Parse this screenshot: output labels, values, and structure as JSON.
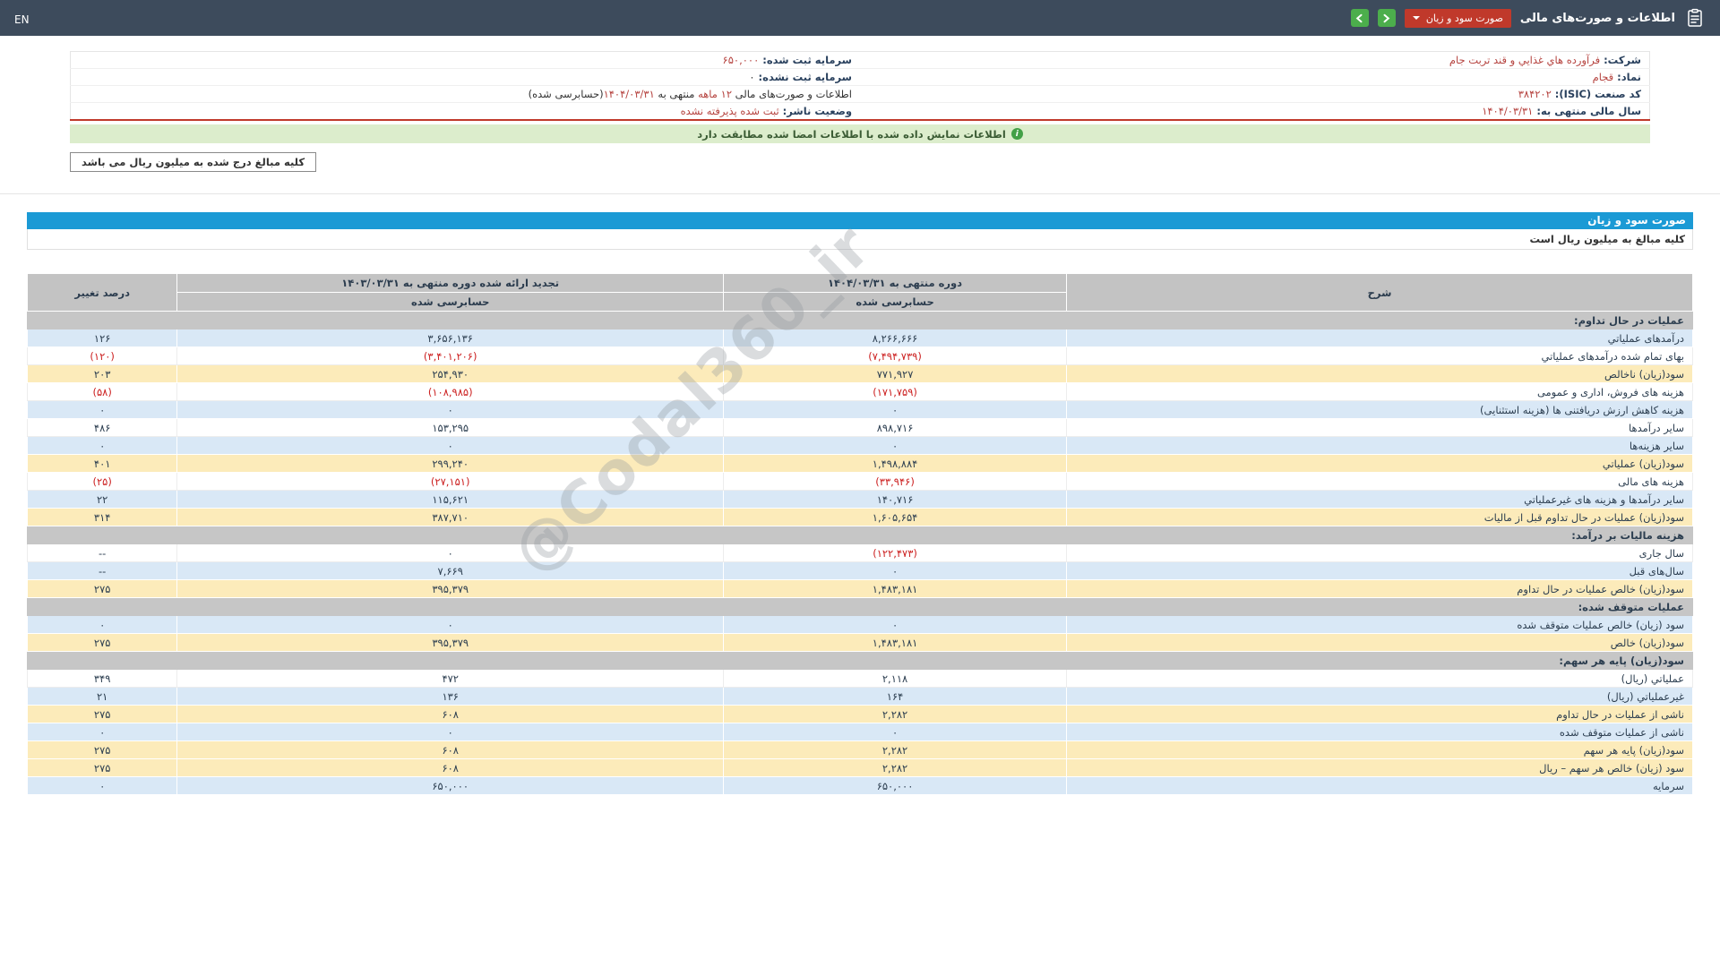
{
  "navbar": {
    "en_label": "EN",
    "title": "اطلاعات و صورت‌های مالی",
    "statement_select_label": "صورت سود و زیان",
    "icons": {
      "report_icon": "clipboard",
      "select_caret": "chevron-down",
      "next_button": "chevron-right",
      "prev_button": "chevron-left"
    }
  },
  "info_panel": {
    "rows": [
      {
        "right": [
          {
            "t": "شرکت: ",
            "c": "lbl"
          },
          {
            "t": "فرآورده هاي غذايي و قند تربت جام",
            "c": "red"
          }
        ],
        "left": [
          {
            "t": "سرمایه ثبت شده: ",
            "c": "lbl"
          },
          {
            "t": "۶۵۰,۰۰۰",
            "c": "red"
          }
        ]
      },
      {
        "right": [
          {
            "t": "نماد: ",
            "c": "lbl"
          },
          {
            "t": "قجام",
            "c": "red"
          }
        ],
        "left": [
          {
            "t": "سرمایه ثبت نشده: ",
            "c": "lbl"
          },
          {
            "t": "۰",
            "c": "plain"
          }
        ]
      },
      {
        "right": [
          {
            "t": "کد صنعت (ISIC): ",
            "c": "lbl"
          },
          {
            "t": "۳۸۴۲۰۲",
            "c": "red"
          }
        ],
        "left": [
          {
            "t": "اطلاعات و صورت‌های مالی ",
            "c": "plain"
          },
          {
            "t": "۱۲ ماهه",
            "c": "red"
          },
          {
            "t": " منتهی به ",
            "c": "plain"
          },
          {
            "t": "۱۴۰۴/۰۳/۳۱",
            "c": "red"
          },
          {
            "t": "(حسابرسی شده)",
            "c": "plain"
          }
        ]
      },
      {
        "right": [
          {
            "t": "سال مالی منتهی به: ",
            "c": "lbl"
          },
          {
            "t": "۱۴۰۴/۰۳/۳۱",
            "c": "red"
          }
        ],
        "left": [
          {
            "t": "وضعیت ناشر: ",
            "c": "lbl"
          },
          {
            "t": "ثبت شده پذیرفته نشده",
            "c": "red"
          }
        ]
      }
    ],
    "signature_note": "اطلاعات نمایش داده شده با اطلاعات امضا شده مطابقت دارد",
    "info_icon_glyph": "i",
    "currency_note": "کلیه مبالغ درج شده به میلیون ریال می باشد"
  },
  "statement": {
    "title": "صورت سود و زیان",
    "unit_note": "کلیه مبالغ به میلیون ریال است",
    "watermark": "@Codal360_ir",
    "header": {
      "desc": "شرح",
      "current_period": "دوره منتهی به ۱۴۰۴/۰۳/۳۱",
      "prior_period": "تجدید ارائه شده دوره منتهی به ۱۴۰۳/۰۳/۳۱",
      "audited": "حسابرسی شده",
      "change": "درصد تغییر"
    },
    "rows": [
      {
        "type": "section",
        "desc": "عملیات در حال تداوم:"
      },
      {
        "type": "data",
        "style": "blue",
        "desc": "درآمدهای عملیاتي",
        "current": "۸,۲۶۶,۶۶۶",
        "prior": "۳,۶۵۶,۱۳۶",
        "change": "۱۲۶"
      },
      {
        "type": "data",
        "style": "white",
        "desc": "بهای تمام شده درآمدهای عملیاتي",
        "current": "(۷,۴۹۴,۷۳۹)",
        "prior": "(۳,۴۰۱,۲۰۶)",
        "change": "(۱۲۰)"
      },
      {
        "type": "data",
        "style": "yellow",
        "desc": "سود(زیان) ناخالص",
        "current": "۷۷۱,۹۲۷",
        "prior": "۲۵۴,۹۳۰",
        "change": "۲۰۳"
      },
      {
        "type": "data",
        "style": "white",
        "desc": "هزینه های فروش، اداری و عمومی",
        "current": "(۱۷۱,۷۵۹)",
        "prior": "(۱۰۸,۹۸۵)",
        "change": "(۵۸)"
      },
      {
        "type": "data",
        "style": "blue",
        "desc": "هزینه کاهش ارزش دریافتنی ها (هزینه استثنایی)",
        "current": "۰",
        "prior": "۰",
        "change": "۰"
      },
      {
        "type": "data",
        "style": "white",
        "desc": "سایر درآمدها",
        "current": "۸۹۸,۷۱۶",
        "prior": "۱۵۳,۲۹۵",
        "change": "۴۸۶"
      },
      {
        "type": "data",
        "style": "blue",
        "desc": "سایر هزینه‌ها",
        "current": "۰",
        "prior": "۰",
        "change": "۰"
      },
      {
        "type": "data",
        "style": "yellow",
        "desc": "سود(زیان) عملیاتي",
        "current": "۱,۴۹۸,۸۸۴",
        "prior": "۲۹۹,۲۴۰",
        "change": "۴۰۱"
      },
      {
        "type": "data",
        "style": "white",
        "desc": "هزینه های مالی",
        "current": "(۳۳,۹۴۶)",
        "prior": "(۲۷,۱۵۱)",
        "change": "(۲۵)"
      },
      {
        "type": "data",
        "style": "blue",
        "desc": "سایر درآمدها و هزینه های غیرعملیاتي",
        "current": "۱۴۰,۷۱۶",
        "prior": "۱۱۵,۶۲۱",
        "change": "۲۲"
      },
      {
        "type": "data",
        "style": "yellow",
        "desc": "سود(زیان) عملیات در حال تداوم قبل از مالیات",
        "current": "۱,۶۰۵,۶۵۴",
        "prior": "۳۸۷,۷۱۰",
        "change": "۳۱۴"
      },
      {
        "type": "section",
        "desc": "هزینه مالیات بر درآمد:"
      },
      {
        "type": "data",
        "style": "white",
        "desc": "سال جاری",
        "current": "(۱۲۲,۴۷۳)",
        "prior": "۰",
        "change": "--"
      },
      {
        "type": "data",
        "style": "blue",
        "desc": "سال‌های قبل",
        "current": "۰",
        "prior": "۷,۶۶۹",
        "change": "--"
      },
      {
        "type": "data",
        "style": "yellow",
        "desc": "سود(زیان) خالص عملیات در حال تداوم",
        "current": "۱,۴۸۳,۱۸۱",
        "prior": "۳۹۵,۳۷۹",
        "change": "۲۷۵"
      },
      {
        "type": "section",
        "desc": "عملیات متوقف شده:"
      },
      {
        "type": "data",
        "style": "blue",
        "desc": "سود (زیان) خالص عملیات متوقف شده",
        "current": "۰",
        "prior": "۰",
        "change": "۰"
      },
      {
        "type": "data",
        "style": "yellow",
        "desc": "سود(زیان) خالص",
        "current": "۱,۴۸۳,۱۸۱",
        "prior": "۳۹۵,۳۷۹",
        "change": "۲۷۵"
      },
      {
        "type": "section",
        "desc": "سود(زیان) پایه هر سهم:"
      },
      {
        "type": "data",
        "style": "white",
        "desc": "عملیاتي (ریال)",
        "current": "۲,۱۱۸",
        "prior": "۴۷۲",
        "change": "۳۴۹"
      },
      {
        "type": "data",
        "style": "blue",
        "desc": "غیرعملیاتي (ریال)",
        "current": "۱۶۴",
        "prior": "۱۳۶",
        "change": "۲۱"
      },
      {
        "type": "data",
        "style": "yellow",
        "desc": "ناشی از عملیات در حال تداوم",
        "current": "۲,۲۸۲",
        "prior": "۶۰۸",
        "change": "۲۷۵"
      },
      {
        "type": "data",
        "style": "blue",
        "desc": "ناشی از عملیات متوقف شده",
        "current": "۰",
        "prior": "۰",
        "change": "۰"
      },
      {
        "type": "data",
        "style": "yellow",
        "desc": "سود(زیان) پایه هر سهم",
        "current": "۲,۲۸۲",
        "prior": "۶۰۸",
        "change": "۲۷۵"
      },
      {
        "type": "data",
        "style": "yellow",
        "desc": "سود (زیان) خالص هر سهم – ریال",
        "current": "۲,۲۸۲",
        "prior": "۶۰۸",
        "change": "۲۷۵"
      },
      {
        "type": "data",
        "style": "blue",
        "desc": "سرمایه",
        "current": "۶۵۰,۰۰۰",
        "prior": "۶۵۰,۰۰۰",
        "change": "۰"
      }
    ]
  },
  "colors": {
    "navbar_bg": "#3d4b5c",
    "accent_blue": "#1b9ad5",
    "row_blue": "#d9e8f6",
    "row_yellow": "#fcebba",
    "section_gray": "#c6c6c6",
    "negative_red": "#cc2020",
    "info_value_red": "#b5423e",
    "select_red": "#c0392b",
    "nav_green": "#4cae4c",
    "banner_green_bg": "#dcedcc",
    "divider_red": "#c0392b"
  }
}
